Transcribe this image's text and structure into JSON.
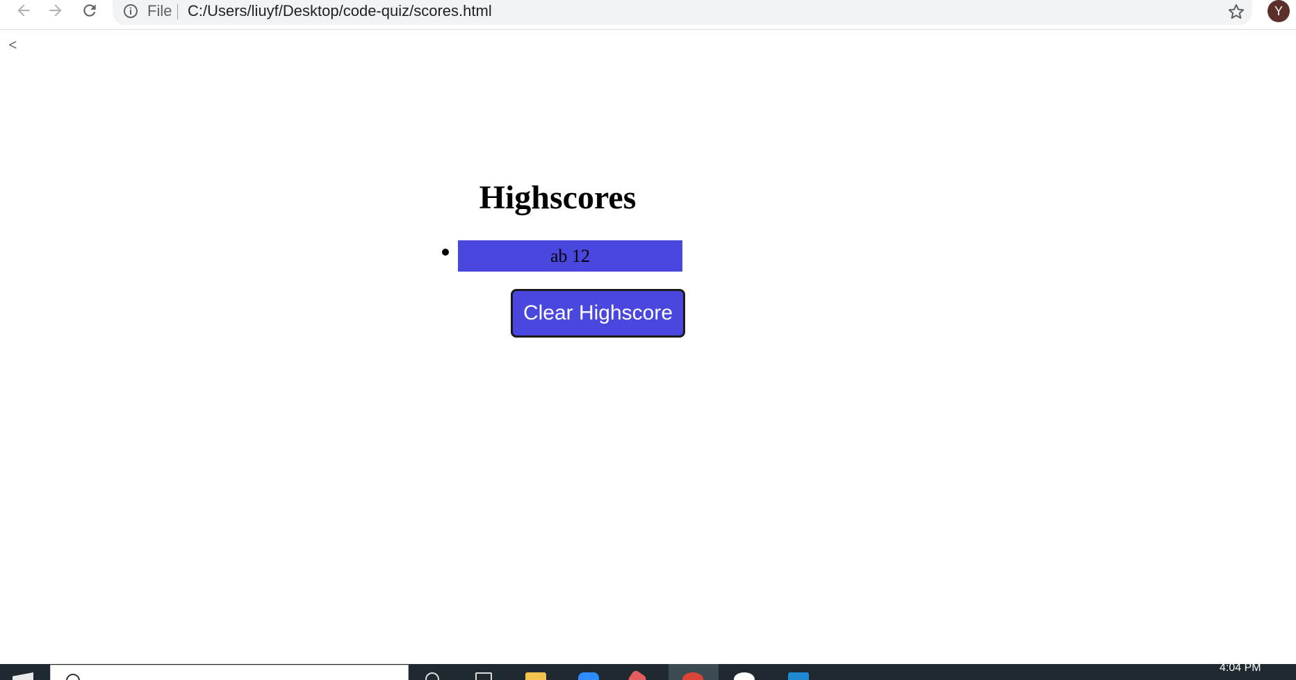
{
  "browser": {
    "scheme_label": "File",
    "url": "C:/Users/liuyf/Desktop/code-quiz/scores.html",
    "avatar_initial": "Y"
  },
  "page": {
    "back_link": "<",
    "title": "Highscores",
    "scores": [
      "ab 12"
    ],
    "clear_button": "Clear Highscore",
    "accent_color": "#4a47df"
  },
  "taskbar": {
    "clock": "4:04 PM",
    "icons": [
      "windows-start-icon",
      "search-icon",
      "cortana-icon",
      "task-view-icon",
      "file-explorer-icon",
      "zoom-icon",
      "paint-icon",
      "chrome-icon",
      "slack-icon",
      "vscode-icon"
    ]
  }
}
